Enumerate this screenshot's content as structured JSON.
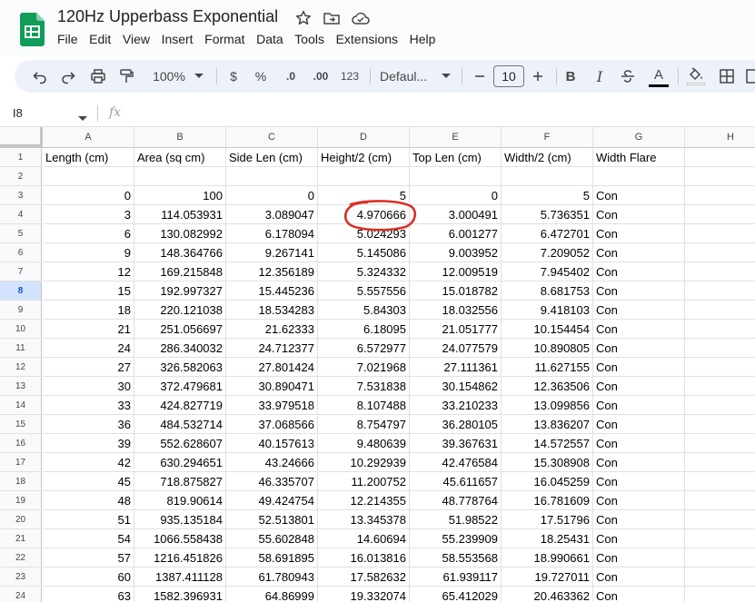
{
  "doc": {
    "title": "120Hz Upperbass Exponential",
    "menu": [
      "File",
      "Edit",
      "View",
      "Insert",
      "Format",
      "Data",
      "Tools",
      "Extensions",
      "Help"
    ]
  },
  "toolbar": {
    "zoom": "100%",
    "currency": "$",
    "percent": "%",
    "decrease_decimal": ".0",
    "increase_decimal": ".00",
    "number_format": "123",
    "font": "Defaul...",
    "font_size": "10",
    "bold": "B",
    "italic": "I",
    "text_color": "A"
  },
  "formula_bar": {
    "name_box": "I8",
    "fx": "fx"
  },
  "sheet": {
    "columns": [
      "A",
      "B",
      "C",
      "D",
      "E",
      "F",
      "G",
      "H"
    ],
    "active_row": 8,
    "rows": [
      {
        "n": 1,
        "cells": [
          "Length (cm)",
          "Area (sq cm)",
          "Side Len (cm)",
          "Height/2 (cm)",
          "Top Len (cm)",
          "Width/2 (cm)",
          "Width Flare",
          ""
        ]
      },
      {
        "n": 2,
        "cells": [
          "",
          "",
          "",
          "",
          "",
          "",
          "",
          ""
        ]
      },
      {
        "n": 3,
        "cells": [
          "0",
          "100",
          "0",
          "5",
          "0",
          "5",
          "Con",
          ""
        ]
      },
      {
        "n": 4,
        "cells": [
          "3",
          "114.053931",
          "3.089047",
          "4.970666",
          "3.000491",
          "5.736351",
          "Con",
          ""
        ]
      },
      {
        "n": 5,
        "cells": [
          "6",
          "130.082992",
          "6.178094",
          "5.024293",
          "6.001277",
          "6.472701",
          "Con",
          ""
        ]
      },
      {
        "n": 6,
        "cells": [
          "9",
          "148.364766",
          "9.267141",
          "5.145086",
          "9.003952",
          "7.209052",
          "Con",
          ""
        ]
      },
      {
        "n": 7,
        "cells": [
          "12",
          "169.215848",
          "12.356189",
          "5.324332",
          "12.009519",
          "7.945402",
          "Con",
          ""
        ]
      },
      {
        "n": 8,
        "cells": [
          "15",
          "192.997327",
          "15.445236",
          "5.557556",
          "15.018782",
          "8.681753",
          "Con",
          ""
        ]
      },
      {
        "n": 9,
        "cells": [
          "18",
          "220.121038",
          "18.534283",
          "5.84303",
          "18.032556",
          "9.418103",
          "Con",
          ""
        ]
      },
      {
        "n": 10,
        "cells": [
          "21",
          "251.056697",
          "21.62333",
          "6.18095",
          "21.051777",
          "10.154454",
          "Con",
          ""
        ]
      },
      {
        "n": 11,
        "cells": [
          "24",
          "286.340032",
          "24.712377",
          "6.572977",
          "24.077579",
          "10.890805",
          "Con",
          ""
        ]
      },
      {
        "n": 12,
        "cells": [
          "27",
          "326.582063",
          "27.801424",
          "7.021968",
          "27.111361",
          "11.627155",
          "Con",
          ""
        ]
      },
      {
        "n": 13,
        "cells": [
          "30",
          "372.479681",
          "30.890471",
          "7.531838",
          "30.154862",
          "12.363506",
          "Con",
          ""
        ]
      },
      {
        "n": 14,
        "cells": [
          "33",
          "424.827719",
          "33.979518",
          "8.107488",
          "33.210233",
          "13.099856",
          "Con",
          ""
        ]
      },
      {
        "n": 15,
        "cells": [
          "36",
          "484.532714",
          "37.068566",
          "8.754797",
          "36.280105",
          "13.836207",
          "Con",
          ""
        ]
      },
      {
        "n": 16,
        "cells": [
          "39",
          "552.628607",
          "40.157613",
          "9.480639",
          "39.367631",
          "14.572557",
          "Con",
          ""
        ]
      },
      {
        "n": 17,
        "cells": [
          "42",
          "630.294651",
          "43.24666",
          "10.292939",
          "42.476584",
          "15.308908",
          "Con",
          ""
        ]
      },
      {
        "n": 18,
        "cells": [
          "45",
          "718.875827",
          "46.335707",
          "11.200752",
          "45.611657",
          "16.045259",
          "Con",
          ""
        ]
      },
      {
        "n": 19,
        "cells": [
          "48",
          "819.90614",
          "49.424754",
          "12.214355",
          "48.778764",
          "16.781609",
          "Con",
          ""
        ]
      },
      {
        "n": 20,
        "cells": [
          "51",
          "935.135184",
          "52.513801",
          "13.345378",
          "51.98522",
          "17.51796",
          "Con",
          ""
        ]
      },
      {
        "n": 21,
        "cells": [
          "54",
          "1066.558438",
          "55.602848",
          "14.60694",
          "55.239909",
          "18.25431",
          "Con",
          ""
        ]
      },
      {
        "n": 22,
        "cells": [
          "57",
          "1216.451826",
          "58.691895",
          "16.013816",
          "58.553568",
          "18.990661",
          "Con",
          ""
        ]
      },
      {
        "n": 23,
        "cells": [
          "60",
          "1387.411128",
          "61.780943",
          "17.582632",
          "61.939117",
          "19.727011",
          "Con",
          ""
        ]
      },
      {
        "n": 24,
        "cells": [
          "63",
          "1582.396931",
          "64.86999",
          "19.332074",
          "65.412029",
          "20.463362",
          "Con",
          ""
        ]
      }
    ]
  },
  "colors": {
    "sheets_green": "#0f9d58",
    "annotation_red": "#d93025",
    "active_row_header": "#d3e3fd"
  }
}
